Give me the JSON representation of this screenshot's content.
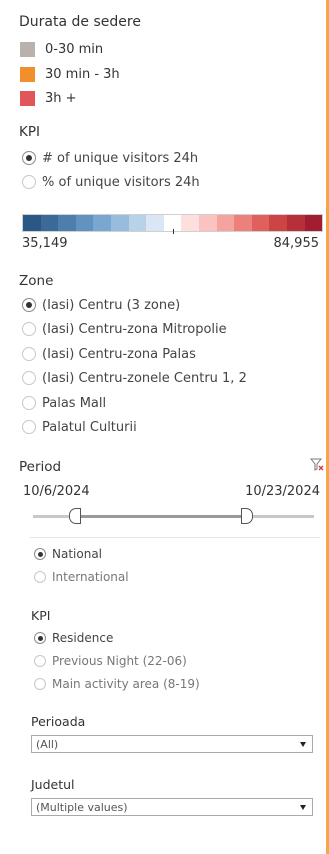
{
  "legend": {
    "title": "Durata de sedere",
    "items": [
      {
        "label": "0-30 min",
        "color": "#bab0ac"
      },
      {
        "label": "30 min - 3h",
        "color": "#f28e2b"
      },
      {
        "label": "3h +",
        "color": "#e15759"
      }
    ]
  },
  "kpi": {
    "title": "KPI",
    "options": [
      {
        "label": "# of unique visitors 24h",
        "selected": true
      },
      {
        "label": "% of unique visitors 24h",
        "selected": false
      }
    ]
  },
  "color_scale": {
    "min_label": "35,149",
    "max_label": "84,955",
    "colors": [
      "#2a5783",
      "#3b6a98",
      "#4d7eae",
      "#6293c0",
      "#7aa7cf",
      "#98bcdc",
      "#b8d2e8",
      "#d8e7f3",
      "#ffffff",
      "#fde0dd",
      "#fac3bf",
      "#f4a39d",
      "#ec817b",
      "#e0605d",
      "#cc4444",
      "#b6303a",
      "#a01d32"
    ]
  },
  "zone": {
    "title": "Zone",
    "options": [
      {
        "label": "(Iasi) Centru (3 zone)",
        "selected": true
      },
      {
        "label": "(Iasi) Centru-zona Mitropolie",
        "selected": false
      },
      {
        "label": "(Iasi) Centru-zona Palas",
        "selected": false
      },
      {
        "label": "(Iasi) Centru-zonele Centru 1, 2",
        "selected": false
      },
      {
        "label": "Palas Mall",
        "selected": false
      },
      {
        "label": "Palatul Culturii",
        "selected": false
      }
    ]
  },
  "period": {
    "title": "Period",
    "start": "10/6/2024",
    "end": "10/23/2024",
    "clear_filter_icon": "filter-clear-icon"
  },
  "scope": {
    "options": [
      {
        "label": "National",
        "selected": true
      },
      {
        "label": "International",
        "selected": false
      }
    ]
  },
  "kpi2": {
    "title": "KPI",
    "options": [
      {
        "label": "Residence",
        "selected": true
      },
      {
        "label": "Previous Night (22-06)",
        "selected": false
      },
      {
        "label": "Main activity area (8-19)",
        "selected": false
      }
    ]
  },
  "perioada": {
    "title": "Perioada",
    "value": "(All)"
  },
  "judetul": {
    "title": "Judetul",
    "value": "(Multiple values)"
  }
}
